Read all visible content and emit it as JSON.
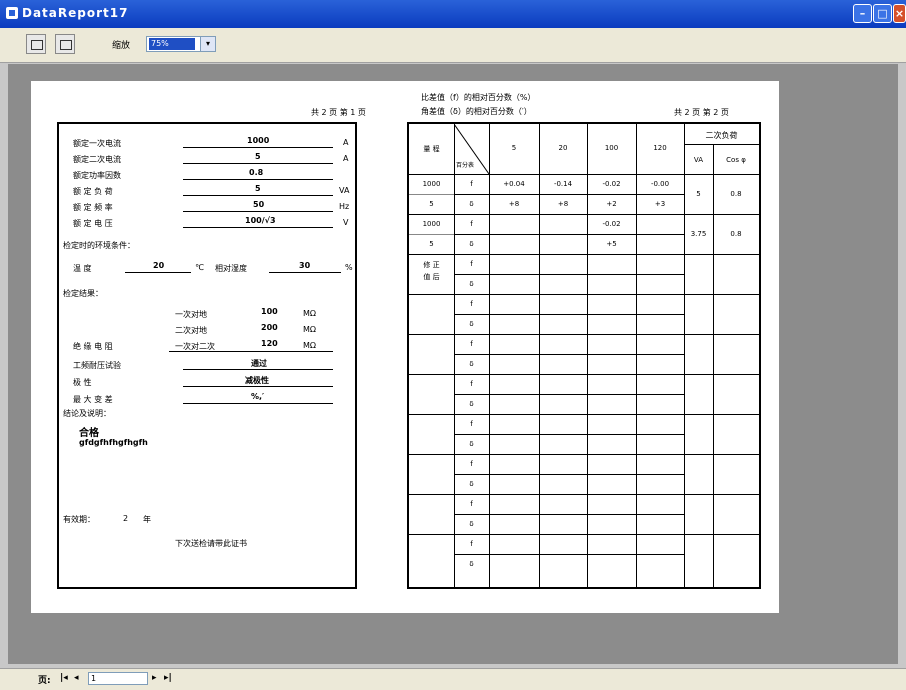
{
  "window": {
    "title": "DataReport17"
  },
  "toolbar": {
    "zoom_label": "缩放",
    "zoom_value": "75%"
  },
  "report": {
    "header_left": "共 2 页 第 1 页",
    "header_right": "共 2 页 第 2 页",
    "caption_ratio": "比差值（f）的相对百分数（%）",
    "caption_angle": "角差值（δ）的相对百分数（′）",
    "rated_primary_label": "额定一次电流",
    "rated_primary_value": "1000",
    "rated_primary_unit": "A",
    "rated_secondary_label": "额定二次电流",
    "rated_secondary_value": "5",
    "rated_secondary_unit": "A",
    "power_factor_label": "额定功率因数",
    "power_factor_value": "0.8",
    "burden_label": "额 定 负 荷",
    "burden_value": "5",
    "burden_unit": "VA",
    "freq_label": "额 定 频 率",
    "freq_value": "50",
    "freq_unit": "Hz",
    "voltage_label": "额 定 电 压",
    "voltage_value": "100/√3",
    "voltage_unit": "V",
    "env_label": "检定时的环境条件：",
    "temp_label": "温  度",
    "temp_value": "20",
    "temp_unit": "℃",
    "humidity_label": "相对湿度",
    "humidity_value": "30",
    "humidity_unit": "%",
    "result_label": "检定结果：",
    "ins1_label": "一次对地",
    "ins1_value": "100",
    "ins1_unit": "MΩ",
    "ins2_label": "二次对地",
    "ins2_value": "200",
    "ins2_unit": "MΩ",
    "ins3_label": "一次对二次",
    "ins3_value": "120",
    "ins3_unit": "MΩ",
    "insulation_label": "绝 缘 电 阻",
    "withstand_label": "工频耐压试验",
    "withstand_value": "通过",
    "polarity_label": "极      性",
    "polarity_value": "减极性",
    "max_error_label": "最 大 变 差",
    "max_error_value": "%,′",
    "conclusion_label": "结论及说明：",
    "conclusion_value": "合格",
    "conclusion_note": "gfdgfhfhgfhgfh",
    "validity_label": "有效期：",
    "validity_value": "2",
    "validity_unit": "年",
    "footer_note": "下次送检请带此证书"
  },
  "table": {
    "col_range": "量 程",
    "col_diag": "百分表",
    "percents": [
      "5",
      "20",
      "100",
      "120"
    ],
    "secondary_burden": "二次负荷",
    "va_label": "VA",
    "cos_label": "Cos φ",
    "row1_range": "1000",
    "row1_range2": "5",
    "row2_range": "1000",
    "row2_range2": "5",
    "f_symbol": "f",
    "d_symbol": "δ",
    "r1f": [
      "+0.04",
      "-0.14",
      "-0.02",
      "-0.00"
    ],
    "r1d": [
      "+8",
      "+8",
      "+2",
      "+3"
    ],
    "r1_va": "5",
    "r1_cos": "0.8",
    "r2f_100": "-0.02",
    "r2d_100": "+5",
    "r2_va": "3.75",
    "r2_cos": "0.8",
    "misc_label1": "修 正",
    "misc_label2": "值 后"
  },
  "statusbar": {
    "pages_label": "页:",
    "page_value": "1"
  }
}
